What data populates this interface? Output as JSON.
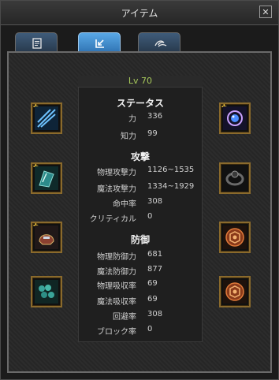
{
  "window": {
    "title": "アイテム",
    "close_label": "✕"
  },
  "tabs": [
    {
      "name": "tab-document",
      "icon": "document-icon",
      "active": false
    },
    {
      "name": "tab-equipment",
      "icon": "equip-arrow-icon",
      "active": true
    },
    {
      "name": "tab-wings",
      "icon": "wing-swirl-icon",
      "active": false
    }
  ],
  "level": {
    "label": "Lv 70"
  },
  "status": {
    "title": "ステータス",
    "rows": [
      {
        "label": "力",
        "value": "336"
      },
      {
        "label": "知力",
        "value": "99"
      }
    ]
  },
  "attack": {
    "title": "攻撃",
    "rows": [
      {
        "label": "物理攻撃力",
        "value": "1126~1535"
      },
      {
        "label": "魔法攻撃力",
        "value": "1334~1929"
      },
      {
        "label": "命中率",
        "value": "308"
      },
      {
        "label": "クリティカル",
        "value": "0"
      }
    ]
  },
  "defense": {
    "title": "防御",
    "rows": [
      {
        "label": "物理防御力",
        "value": "681"
      },
      {
        "label": "魔法防御力",
        "value": "877"
      },
      {
        "label": "物理吸収率",
        "value": "69"
      },
      {
        "label": "魔法吸収率",
        "value": "69"
      },
      {
        "label": "回避率",
        "value": "308"
      },
      {
        "label": "ブロック率",
        "value": "0"
      }
    ]
  },
  "equipment_slots": {
    "left": [
      {
        "name": "slot-weapon",
        "icon": "blue-blade-icon",
        "enhanced": true
      },
      {
        "name": "slot-armor",
        "icon": "teal-armor-icon",
        "enhanced": true
      },
      {
        "name": "slot-helmet",
        "icon": "helmet-icon",
        "enhanced": true
      },
      {
        "name": "slot-gloves",
        "icon": "teal-gloves-icon",
        "enhanced": false
      }
    ],
    "right": [
      {
        "name": "slot-amulet",
        "icon": "blue-amulet-icon",
        "enhanced": true
      },
      {
        "name": "slot-ring",
        "icon": "dark-ring-icon",
        "enhanced": false
      },
      {
        "name": "slot-emblem-1",
        "icon": "orange-emblem-icon",
        "enhanced": false
      },
      {
        "name": "slot-emblem-2",
        "icon": "orange-emblem-icon",
        "enhanced": false
      }
    ]
  },
  "colors": {
    "level_text": "#a6c85a",
    "slot_border": "#8a6a2c",
    "active_tab": "#4a96d6"
  }
}
